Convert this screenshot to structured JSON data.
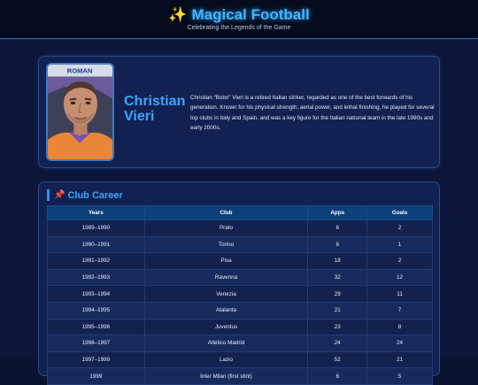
{
  "header": {
    "sparkle_icon": "sparkles-icon",
    "title": "Magical Football",
    "tagline": "Celebrating the Legends of the Game"
  },
  "profile": {
    "name": "Christian Vieri",
    "bio": "Christian “Bobo” Vieri is a retired Italian striker, regarded as one of the best forwards of his generation. Known for his physical strength, aerial power, and lethal finishing, he played for several top clubs in Italy and Spain, and was a key figure for the Italian national team in the late 1990s and early 2000s.",
    "photo_banner_text": "ROMAN"
  },
  "career": {
    "icon": "pushpin-icon",
    "title": "Club Career",
    "columns": [
      "Years",
      "Club",
      "Apps",
      "Goals"
    ],
    "rows": [
      {
        "years": "1989–1990",
        "club": "Prato",
        "apps": "6",
        "goals": "2"
      },
      {
        "years": "1990–1991",
        "club": "Torino",
        "apps": "6",
        "goals": "1"
      },
      {
        "years": "1991–1992",
        "club": "Pisa",
        "apps": "18",
        "goals": "2"
      },
      {
        "years": "1992–1993",
        "club": "Ravenna",
        "apps": "32",
        "goals": "12"
      },
      {
        "years": "1993–1994",
        "club": "Venezia",
        "apps": "29",
        "goals": "11"
      },
      {
        "years": "1994–1995",
        "club": "Atalanta",
        "apps": "21",
        "goals": "7"
      },
      {
        "years": "1995–1996",
        "club": "Juventus",
        "apps": "23",
        "goals": "8"
      },
      {
        "years": "1996–1997",
        "club": "Atlético Madrid",
        "apps": "24",
        "goals": "24"
      },
      {
        "years": "1997–1999",
        "club": "Lazio",
        "apps": "52",
        "goals": "21"
      },
      {
        "years": "1999",
        "club": "Inter Milan (first stint)",
        "apps": "6",
        "goals": "5"
      }
    ]
  },
  "colors": {
    "accent": "#3aa6ff",
    "background": "#0b1638",
    "card": "#122152",
    "table_header": "#0d3f7a"
  }
}
